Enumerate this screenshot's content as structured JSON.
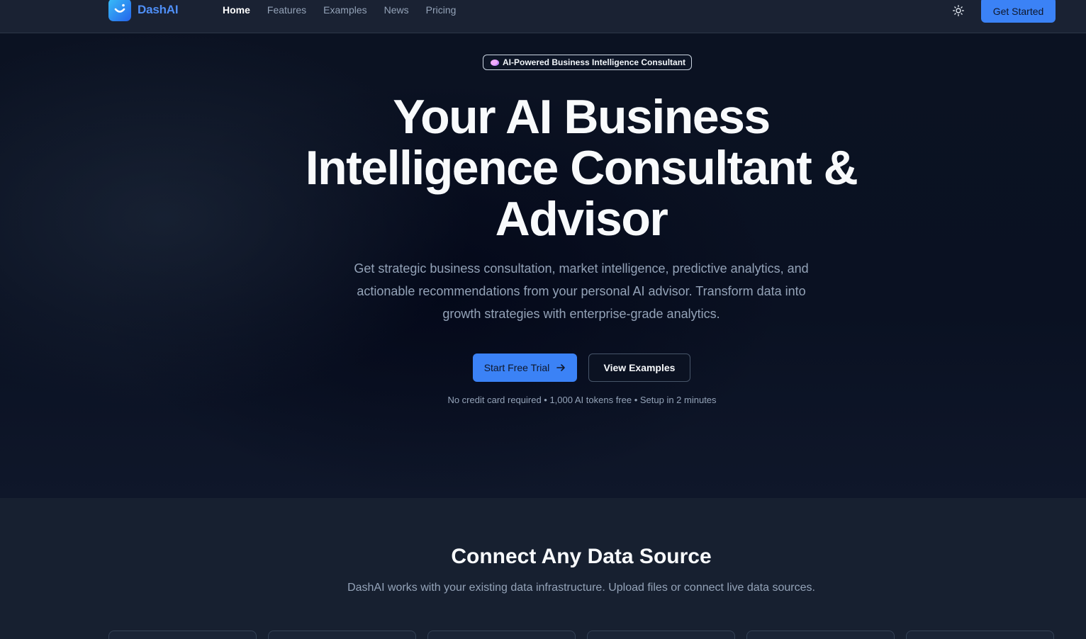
{
  "nav": {
    "brand": "DashAI",
    "links": [
      {
        "label": "Home",
        "active": true
      },
      {
        "label": "Features",
        "active": false
      },
      {
        "label": "Examples",
        "active": false
      },
      {
        "label": "News",
        "active": false
      },
      {
        "label": "Pricing",
        "active": false
      }
    ],
    "theme_icon": "sun-icon",
    "cta_label": "Get Started"
  },
  "hero": {
    "badge": "AI-Powered Business Intelligence Consultant",
    "badge_icon": "brain-icon",
    "title": "Your AI Business Intelligence Consultant & Advisor",
    "description": "Get strategic business consultation, market intelligence, predictive analytics, and actionable recommendations from your personal AI advisor. Transform data into growth strategies with enterprise-grade analytics.",
    "primary_cta": "Start Free Trial",
    "primary_cta_icon": "arrow-right-icon",
    "secondary_cta": "View Examples",
    "note": "No credit card required • 1,000 AI tokens free • Setup in 2 minutes"
  },
  "connect": {
    "title": "Connect Any Data Source",
    "subtitle": "DashAI works with your existing data infrastructure. Upload files or connect live data sources."
  },
  "colors": {
    "accent": "#3b82f6",
    "background": "#0f172a",
    "muted_text": "#94a3b8"
  }
}
